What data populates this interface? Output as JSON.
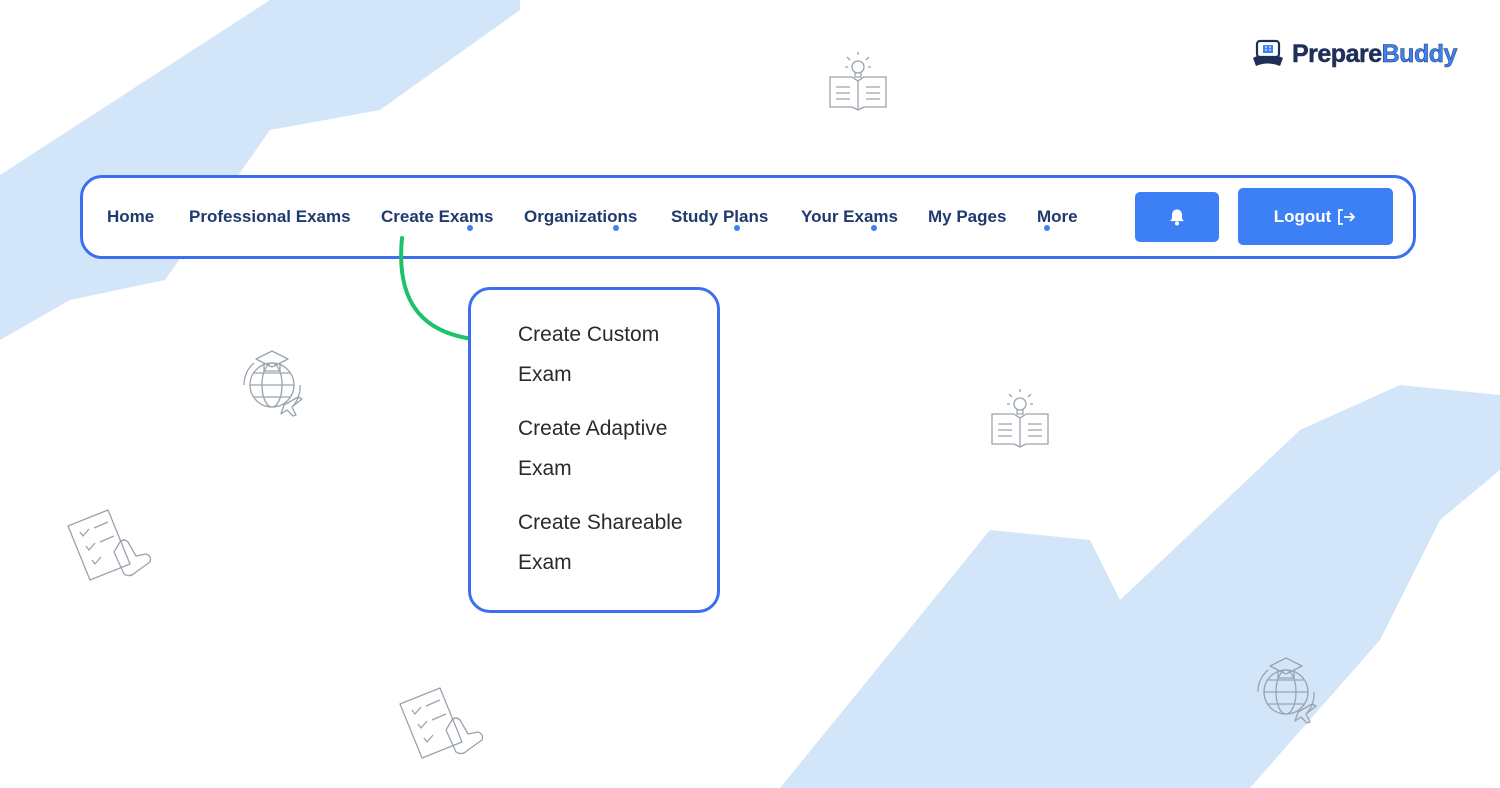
{
  "brand": {
    "name_part1": "Prepare",
    "name_part2": "Buddy",
    "colors": {
      "dark": "#1f2f57",
      "accent": "#3b82f6"
    }
  },
  "nav": {
    "items": [
      {
        "label": "Home"
      },
      {
        "label": "Professional Exams"
      },
      {
        "label": "Create Exams"
      },
      {
        "label": "Organizations"
      },
      {
        "label": "Study Plans"
      },
      {
        "label": "Your Exams"
      },
      {
        "label": "My Pages"
      },
      {
        "label": "More"
      }
    ],
    "bell_icon": "bell-icon",
    "logout_label": "Logout",
    "logout_icon": "logout-arrow-icon"
  },
  "dropdown": {
    "items": [
      {
        "label": "Create Custom Exam"
      },
      {
        "label": "Create Adaptive Exam"
      },
      {
        "label": "Create Shareable Exam"
      }
    ]
  },
  "decorations": {
    "icons": [
      "open-book-lightbulb-icon",
      "graduation-globe-airplane-icon",
      "checklist-hand-icon"
    ],
    "arrow_color": "#1ec26a",
    "stroke_color": "#d3e6f9"
  }
}
